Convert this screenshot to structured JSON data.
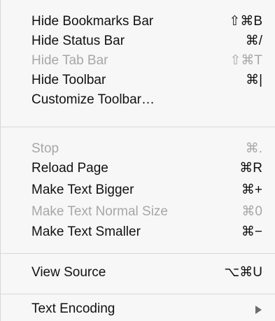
{
  "menu": {
    "items": [
      {
        "label": "Hide Bookmarks Bar",
        "shortcut": "⇧⌘B",
        "enabled": true
      },
      {
        "label": "Hide Status Bar",
        "shortcut": "⌘/",
        "enabled": true
      },
      {
        "label": "Hide Tab Bar",
        "shortcut": "⇧⌘T",
        "enabled": false
      },
      {
        "label": "Hide Toolbar",
        "shortcut": "⌘|",
        "enabled": true
      },
      {
        "label": "Customize Toolbar…",
        "shortcut": "",
        "enabled": true
      },
      {
        "label": "Stop",
        "shortcut": "⌘.",
        "enabled": false
      },
      {
        "label": "Reload Page",
        "shortcut": "⌘R",
        "enabled": true
      },
      {
        "label": "Make Text Bigger",
        "shortcut": "⌘+",
        "enabled": true
      },
      {
        "label": "Make Text Normal Size",
        "shortcut": "⌘0",
        "enabled": false
      },
      {
        "label": "Make Text Smaller",
        "shortcut": "⌘−",
        "enabled": true
      },
      {
        "label": "View Source",
        "shortcut": "⌥⌘U",
        "enabled": true
      },
      {
        "label": "Text Encoding",
        "shortcut": "",
        "enabled": true,
        "submenu": true
      }
    ]
  },
  "colors": {
    "text": "#111111",
    "disabled_text": "#a7a7a7",
    "background": "#f7f7f7",
    "separator": "#d9d9d9",
    "submenu_arrow": "#6b6b6b"
  }
}
